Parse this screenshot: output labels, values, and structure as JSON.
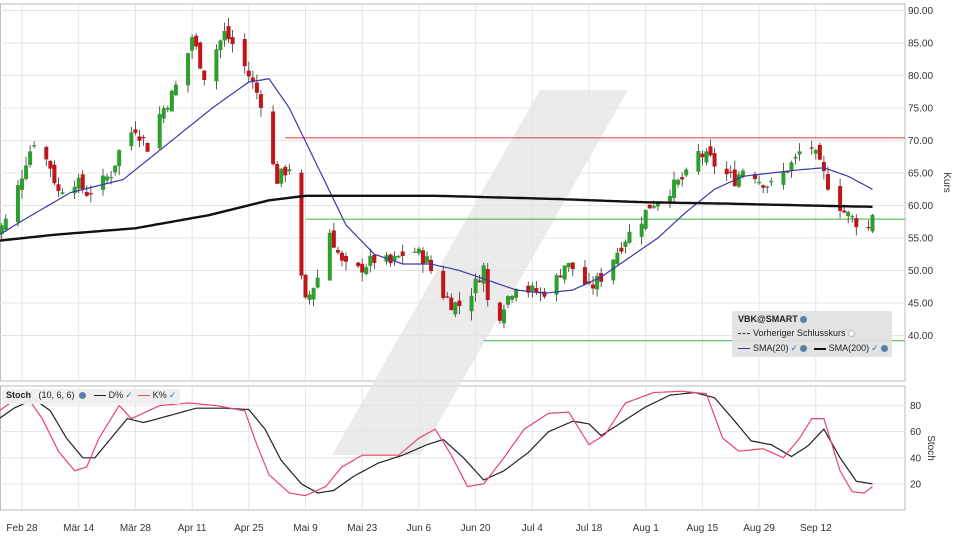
{
  "chart_data": [
    {
      "type": "candlestick",
      "symbol_label": "VBK@SMART",
      "ylabel": "Kurs",
      "ylim": [
        33,
        91
      ],
      "y_ticks": [
        "40.00",
        "45.00",
        "50.00",
        "55.00",
        "60.00",
        "65.00",
        "70.00",
        "75.00",
        "80.00",
        "85.00",
        "90.00"
      ],
      "x_ticks": [
        "Feb 28",
        "Mär 14",
        "Mär 28",
        "Apr 11",
        "Apr 25",
        "Mai 9",
        "Mai 23",
        "Jun 6",
        "Jun 20",
        "Jul 4",
        "Jul 18",
        "Aug 1",
        "Aug 15",
        "Aug 29",
        "Sep 12"
      ],
      "legend": {
        "prev_close": "Vorheriger Schlusskurs",
        "sma20": "SMA(20)",
        "sma200": "SMA(200)"
      },
      "horizontal_lines": [
        {
          "value": 70.4,
          "color": "#e03a3a",
          "from": "Mai 4"
        },
        {
          "value": 57.9,
          "color": "#3cb043",
          "from": "Mai 9"
        },
        {
          "value": 39.2,
          "color": "#3cb043",
          "from": "Jun 22"
        }
      ],
      "close_path": [
        [
          "Feb 21",
          55.0
        ],
        [
          "Feb 25",
          58.5
        ],
        [
          "Mär 1",
          67.0
        ],
        [
          "Mär 3",
          70.0
        ],
        [
          "Mär 7",
          66.0
        ],
        [
          "Mär 9",
          62.0
        ],
        [
          "Mär 12",
          64.5
        ],
        [
          "Mär 16",
          62.0
        ],
        [
          "Mär 19",
          63.0
        ],
        [
          "Mär 22",
          65.0
        ],
        [
          "Mär 25",
          70.0
        ],
        [
          "Mär 28",
          72.0
        ],
        [
          "Mär 31",
          69.0
        ],
        [
          "Apr 3",
          74.0
        ],
        [
          "Apr 6",
          77.0
        ],
        [
          "Apr 9",
          81.0
        ],
        [
          "Apr 11",
          86.0
        ],
        [
          "Apr 14",
          80.0
        ],
        [
          "Apr 16",
          83.0
        ],
        [
          "Apr 19",
          86.5
        ],
        [
          "Apr 22",
          84.0
        ],
        [
          "Apr 25",
          80.0
        ],
        [
          "Apr 28",
          76.0
        ],
        [
          "Apr 30",
          68.0
        ],
        [
          "Mai 2",
          64.0
        ],
        [
          "Mai 5",
          66.0
        ],
        [
          "Mai 7",
          52.0
        ],
        [
          "Mai 9",
          45.0
        ],
        [
          "Mai 12",
          49.0
        ],
        [
          "Mai 15",
          56.0
        ],
        [
          "Mai 18",
          51.0
        ],
        [
          "Mai 21",
          49.5
        ],
        [
          "Mai 24",
          51.0
        ],
        [
          "Mai 27",
          52.0
        ],
        [
          "Mai 30",
          51.0
        ],
        [
          "Jun 2",
          52.5
        ],
        [
          "Jun 5",
          53.0
        ],
        [
          "Jun 8",
          51.5
        ],
        [
          "Jun 11",
          47.0
        ],
        [
          "Jun 14",
          45.0
        ],
        [
          "Jun 17",
          44.5
        ],
        [
          "Jun 20",
          48.0
        ],
        [
          "Jun 22",
          50.5
        ],
        [
          "Jun 24",
          40.0
        ],
        [
          "Jun 27",
          45.0
        ],
        [
          "Jun 30",
          48.0
        ],
        [
          "Jul 3",
          47.0
        ],
        [
          "Jul 6",
          46.5
        ],
        [
          "Jul 9",
          47.5
        ],
        [
          "Jul 12",
          51.0
        ],
        [
          "Jul 15",
          50.0
        ],
        [
          "Jul 18",
          47.0
        ],
        [
          "Jul 21",
          49.0
        ],
        [
          "Jul 24",
          52.0
        ],
        [
          "Jul 27",
          55.0
        ],
        [
          "Jul 30",
          57.0
        ],
        [
          "Aug 2",
          60.0
        ],
        [
          "Aug 5",
          61.5
        ],
        [
          "Aug 8",
          63.0
        ],
        [
          "Aug 11",
          64.5
        ],
        [
          "Aug 14",
          68.0
        ],
        [
          "Aug 17",
          67.0
        ],
        [
          "Aug 20",
          65.0
        ],
        [
          "Aug 23",
          64.0
        ],
        [
          "Aug 26",
          66.5
        ],
        [
          "Aug 29",
          64.0
        ],
        [
          "Sep 1",
          63.0
        ],
        [
          "Sep 4",
          65.0
        ],
        [
          "Sep 7",
          67.0
        ],
        [
          "Sep 10",
          70.5
        ],
        [
          "Sep 13",
          66.0
        ],
        [
          "Sep 16",
          62.0
        ],
        [
          "Sep 19",
          59.0
        ],
        [
          "Sep 22",
          57.5
        ],
        [
          "Sep 24",
          54.0
        ],
        [
          "Sep 26",
          59.0
        ]
      ],
      "sma20_path": [
        [
          "Feb 21",
          55.0
        ],
        [
          "Mär 1",
          58.0
        ],
        [
          "Mär 12",
          62.0
        ],
        [
          "Mär 25",
          64.0
        ],
        [
          "Apr 6",
          70.0
        ],
        [
          "Apr 16",
          75.0
        ],
        [
          "Apr 25",
          79.0
        ],
        [
          "Apr 30",
          79.5
        ],
        [
          "Mai 5",
          75.0
        ],
        [
          "Mai 12",
          66.0
        ],
        [
          "Mai 19",
          57.0
        ],
        [
          "Mai 26",
          52.5
        ],
        [
          "Jun 2",
          51.0
        ],
        [
          "Jun 9",
          51.0
        ],
        [
          "Jun 16",
          50.0
        ],
        [
          "Jun 23",
          48.5
        ],
        [
          "Jun 30",
          47.0
        ],
        [
          "Jul 7",
          46.5
        ],
        [
          "Jul 14",
          47.0
        ],
        [
          "Jul 21",
          49.0
        ],
        [
          "Jul 28",
          52.0
        ],
        [
          "Aug 4",
          55.0
        ],
        [
          "Aug 11",
          59.0
        ],
        [
          "Aug 18",
          62.5
        ],
        [
          "Aug 25",
          64.5
        ],
        [
          "Sep 1",
          65.0
        ],
        [
          "Sep 8",
          65.5
        ],
        [
          "Sep 14",
          65.8
        ],
        [
          "Sep 20",
          64.5
        ],
        [
          "Sep 26",
          62.5
        ]
      ],
      "sma200_path": [
        [
          "Feb 21",
          54.5
        ],
        [
          "Mär 8",
          55.5
        ],
        [
          "Mär 28",
          56.5
        ],
        [
          "Apr 15",
          58.5
        ],
        [
          "Apr 30",
          60.8
        ],
        [
          "Mai 9",
          61.5
        ],
        [
          "Jun 10",
          61.5
        ],
        [
          "Jul 10",
          61.0
        ],
        [
          "Aug 1",
          60.5
        ],
        [
          "Aug 20",
          60.3
        ],
        [
          "Sep 10",
          60.0
        ],
        [
          "Sep 26",
          59.8
        ]
      ]
    },
    {
      "type": "line",
      "title": "Stoch",
      "params": "(10, 6, 6)",
      "ylabel": "Stoch",
      "ylim": [
        0,
        95
      ],
      "y_ticks": [
        "20",
        "40",
        "60",
        "80"
      ],
      "series": [
        {
          "name": "D%",
          "color": "#222222",
          "values": [
            [
              "Feb 21",
              67
            ],
            [
              "Feb 26",
              78
            ],
            [
              "Mär 3",
              85
            ],
            [
              "Mär 7",
              76
            ],
            [
              "Mär 11",
              55
            ],
            [
              "Mär 15",
              40
            ],
            [
              "Mär 18",
              40
            ],
            [
              "Mär 22",
              55
            ],
            [
              "Mär 26",
              70
            ],
            [
              "Mär 30",
              67
            ],
            [
              "Apr 5",
              72
            ],
            [
              "Apr 12",
              78
            ],
            [
              "Apr 19",
              78
            ],
            [
              "Apr 25",
              77
            ],
            [
              "Apr 29",
              62
            ],
            [
              "Mai 3",
              38
            ],
            [
              "Mai 8",
              20
            ],
            [
              "Mai 12",
              13
            ],
            [
              "Mai 16",
              15
            ],
            [
              "Mai 21",
              26
            ],
            [
              "Mai 27",
              36
            ],
            [
              "Jun 2",
              42
            ],
            [
              "Jun 8",
              50
            ],
            [
              "Jun 12",
              54
            ],
            [
              "Jun 17",
              40
            ],
            [
              "Jun 22",
              23
            ],
            [
              "Jun 27",
              30
            ],
            [
              "Jul 3",
              44
            ],
            [
              "Jul 8",
              60
            ],
            [
              "Jul 14",
              68
            ],
            [
              "Jul 18",
              66
            ],
            [
              "Jul 21",
              57
            ],
            [
              "Jul 25",
              65
            ],
            [
              "Aug 1",
              79
            ],
            [
              "Aug 7",
              88
            ],
            [
              "Aug 13",
              90
            ],
            [
              "Aug 18",
              86
            ],
            [
              "Aug 23",
              68
            ],
            [
              "Aug 27",
              53
            ],
            [
              "Sep 1",
              50
            ],
            [
              "Sep 6",
              41
            ],
            [
              "Sep 10",
              49
            ],
            [
              "Sep 14",
              62
            ],
            [
              "Sep 18",
              40
            ],
            [
              "Sep 22",
              22
            ],
            [
              "Sep 26",
              20
            ]
          ]
        },
        {
          "name": "K%",
          "color": "#e8456a",
          "values": [
            [
              "Feb 21",
              73
            ],
            [
              "Feb 26",
              84
            ],
            [
              "Mär 1",
              88
            ],
            [
              "Mär 5",
              70
            ],
            [
              "Mär 9",
              45
            ],
            [
              "Mär 13",
              30
            ],
            [
              "Mär 16",
              33
            ],
            [
              "Mär 19",
              55
            ],
            [
              "Mär 24",
              80
            ],
            [
              "Mär 27",
              70
            ],
            [
              "Apr 3",
              80
            ],
            [
              "Apr 10",
              82
            ],
            [
              "Apr 17",
              80
            ],
            [
              "Apr 24",
              76
            ],
            [
              "Apr 27",
              50
            ],
            [
              "Apr 30",
              27
            ],
            [
              "Mai 5",
              13
            ],
            [
              "Mai 9",
              11
            ],
            [
              "Mai 14",
              18
            ],
            [
              "Mai 18",
              33
            ],
            [
              "Mai 23",
              42
            ],
            [
              "Jun 1",
              42
            ],
            [
              "Jun 6",
              55
            ],
            [
              "Jun 10",
              62
            ],
            [
              "Jun 14",
              42
            ],
            [
              "Jun 18",
              18
            ],
            [
              "Jun 22",
              20
            ],
            [
              "Jun 27",
              40
            ],
            [
              "Jul 2",
              62
            ],
            [
              "Jul 8",
              74
            ],
            [
              "Jul 13",
              75
            ],
            [
              "Jul 18",
              50
            ],
            [
              "Jul 22",
              58
            ],
            [
              "Jul 27",
              82
            ],
            [
              "Aug 3",
              90
            ],
            [
              "Aug 10",
              91
            ],
            [
              "Aug 16",
              89
            ],
            [
              "Aug 20",
              55
            ],
            [
              "Aug 24",
              45
            ],
            [
              "Aug 30",
              47
            ],
            [
              "Sep 4",
              40
            ],
            [
              "Sep 8",
              55
            ],
            [
              "Sep 11",
              70
            ],
            [
              "Sep 14",
              70
            ],
            [
              "Sep 18",
              30
            ],
            [
              "Sep 21",
              14
            ],
            [
              "Sep 24",
              13
            ],
            [
              "Sep 26",
              18
            ]
          ]
        }
      ]
    }
  ]
}
